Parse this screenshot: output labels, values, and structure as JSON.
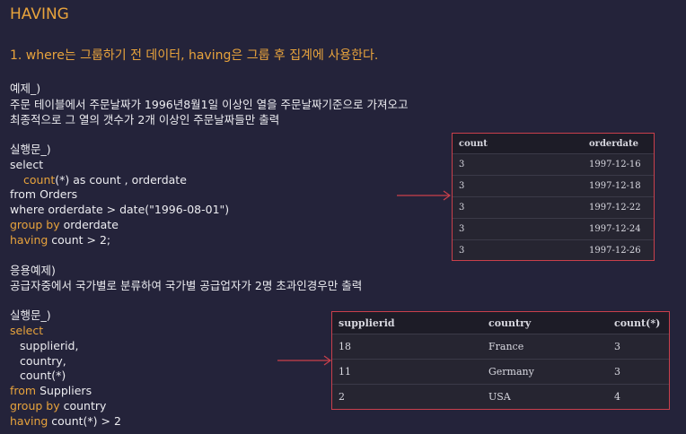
{
  "heading": "HAVING",
  "point1": "1. where는 그룹하기 전 데이터, having은 그룹 후 집계에 사용한다.",
  "example1": {
    "label": "예제_)",
    "desc_line1": "주문 테이블에서 주문날짜가 1996년8월1일 이상인 열을 주문날짜기준으로 가져오고",
    "desc_line2": "최종적으로 그 열의 갯수가 2개 이상인 주문날짜들만 출력",
    "run_label": "실행문_)",
    "code": {
      "l1": "select",
      "l2_fn": "count",
      "l2_rest": "(*) as count , orderdate",
      "l3": "from Orders",
      "l4": "where orderdate > date(\"1996-08-01\")",
      "l5_kw": "group by",
      "l5_rest": " orderdate",
      "l6_kw": "having",
      "l6_rest": " count > 2;"
    },
    "table": {
      "headers": [
        "count",
        "orderdate"
      ],
      "rows": [
        [
          "3",
          "1997-12-16"
        ],
        [
          "3",
          "1997-12-18"
        ],
        [
          "3",
          "1997-12-22"
        ],
        [
          "3",
          "1997-12-24"
        ],
        [
          "3",
          "1997-12-26"
        ]
      ]
    }
  },
  "example2": {
    "label": "응용예제)",
    "desc": "공급자중에서 국가별로 분류하여 국가별 공급업자가 2명 초과인경우만 출력",
    "run_label": "실행문_)",
    "code": {
      "l1": "select",
      "l2": "supplierid,",
      "l3": "country,",
      "l4": "count(*)",
      "l5_kw": "from",
      "l5_rest": " Suppliers",
      "l6_kw": "group by",
      "l6_rest": " country",
      "l7_kw": "having",
      "l7_rest": " count(*) > 2"
    },
    "table": {
      "headers": [
        "supplierid",
        "country",
        "count(*)"
      ],
      "rows": [
        [
          "18",
          "France",
          "3"
        ],
        [
          "11",
          "Germany",
          "3"
        ],
        [
          "2",
          "USA",
          "4"
        ]
      ]
    }
  },
  "colors": {
    "background": "#24233a",
    "accent": "#e8a33c",
    "table_border": "#c9404b",
    "arrow": "#c9404b"
  }
}
